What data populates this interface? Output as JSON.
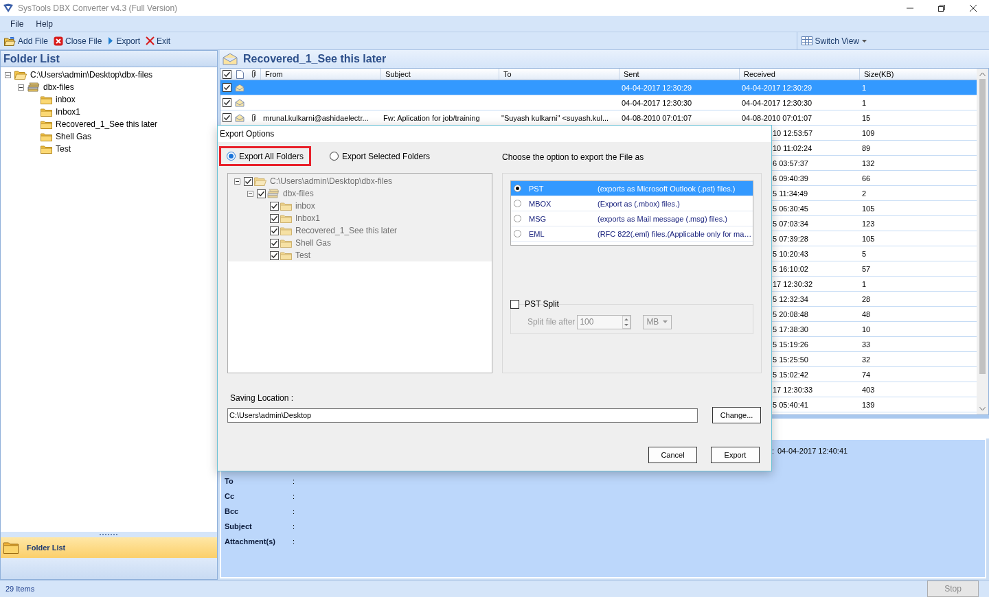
{
  "window": {
    "title": "SysTools DBX Converter v4.3 (Full Version)"
  },
  "menu": [
    "File",
    "Help"
  ],
  "toolbar": {
    "buttons": [
      {
        "kind": "add",
        "label": "Add File"
      },
      {
        "kind": "close",
        "label": "Close File"
      },
      {
        "kind": "export",
        "label": "Export"
      },
      {
        "kind": "exit",
        "label": "Exit"
      }
    ],
    "switch_view": "Switch View"
  },
  "folder_pane": {
    "title": "Folder List",
    "tree": [
      {
        "label": "C:\\Users\\admin\\Desktop\\dbx-files",
        "kind": "root",
        "expanded": true,
        "children": [
          {
            "label": "dbx-files",
            "kind": "store",
            "expanded": true,
            "children": [
              {
                "label": "inbox",
                "kind": "folder"
              },
              {
                "label": "Inbox1",
                "kind": "folder"
              },
              {
                "label": "Recovered_1_See this later",
                "kind": "folder"
              },
              {
                "label": "Shell Gas",
                "kind": "folder"
              },
              {
                "label": "Test",
                "kind": "folder"
              }
            ]
          }
        ]
      }
    ],
    "footer_tab": "Folder List"
  },
  "message_pane": {
    "title": "Recovered_1_See this later",
    "header_checked": true,
    "columns": [
      "From",
      "Subject",
      "To",
      "Sent",
      "Received",
      "Size(KB)"
    ],
    "rows": [
      {
        "kind": "full",
        "checked": true,
        "selected": true,
        "attachment": false,
        "sent": "04-04-2017 12:30:29",
        "received": "04-04-2017 12:30:29",
        "size": "1"
      },
      {
        "kind": "full",
        "checked": true,
        "selected": false,
        "attachment": false,
        "sent": "04-04-2017 12:30:30",
        "received": "04-04-2017 12:30:30",
        "size": "1"
      },
      {
        "kind": "full",
        "checked": true,
        "selected": false,
        "attachment": true,
        "from": "mrunal.kulkarni@ashidaelectr...",
        "subject": "Fw: Aplication for job/training",
        "to": "\"Suyash kulkarni\" <suyash.kul...",
        "sent": "04-08-2010 07:01:07",
        "received": "04-08-2010 07:01:07",
        "size": "15"
      },
      {
        "kind": "partial",
        "received": "10 12:53:57",
        "size": "109"
      },
      {
        "kind": "partial",
        "received": "10 11:02:24",
        "size": "89"
      },
      {
        "kind": "partial",
        "received": "6 03:57:37",
        "size": "132"
      },
      {
        "kind": "partial",
        "received": "6 09:40:39",
        "size": "66"
      },
      {
        "kind": "partial",
        "received": "5 11:34:49",
        "size": "2"
      },
      {
        "kind": "partial",
        "received": "5 06:30:45",
        "size": "105"
      },
      {
        "kind": "partial",
        "received": "5 07:03:34",
        "size": "123"
      },
      {
        "kind": "partial",
        "received": "5 07:39:28",
        "size": "105"
      },
      {
        "kind": "partial",
        "received": "5 10:20:43",
        "size": "5"
      },
      {
        "kind": "partial",
        "received": "5 16:10:02",
        "size": "57"
      },
      {
        "kind": "partial",
        "received": "17 12:30:32",
        "size": "1"
      },
      {
        "kind": "partial",
        "received": "5 12:32:34",
        "size": "28"
      },
      {
        "kind": "partial",
        "received": "5 20:08:48",
        "size": "48"
      },
      {
        "kind": "partial",
        "received": "5 17:38:30",
        "size": "10"
      },
      {
        "kind": "partial",
        "received": "5 15:19:26",
        "size": "33"
      },
      {
        "kind": "partial",
        "received": "5 15:25:50",
        "size": "32"
      },
      {
        "kind": "partial",
        "received": "5 15:02:42",
        "size": "74"
      },
      {
        "kind": "partial",
        "received": "17 12:30:33",
        "size": "403"
      },
      {
        "kind": "partial",
        "received": "5 05:40:41",
        "size": "139"
      }
    ]
  },
  "preview": {
    "date_colon": ":",
    "date_value": "04-04-2017 12:40:41",
    "fields": [
      {
        "label": "To",
        "colon": ":"
      },
      {
        "label": "Cc",
        "colon": ":"
      },
      {
        "label": "Bcc",
        "colon": ":"
      },
      {
        "label": "Subject",
        "colon": ":"
      },
      {
        "label": "Attachment(s)",
        "colon": ":"
      }
    ]
  },
  "dialog": {
    "title": "Export Options",
    "scope": [
      {
        "label": "Export All Folders",
        "selected": true,
        "highlighted": true
      },
      {
        "label": "Export Selected Folders",
        "selected": false,
        "highlighted": false
      }
    ],
    "tree_disabled": true,
    "tree": [
      {
        "label": "C:\\Users\\admin\\Desktop\\dbx-files",
        "kind": "root",
        "checked": true,
        "expanded": true,
        "children": [
          {
            "label": "dbx-files",
            "kind": "store",
            "checked": true,
            "expanded": true,
            "children": [
              {
                "label": "inbox",
                "kind": "folder",
                "checked": true
              },
              {
                "label": "Inbox1",
                "kind": "folder",
                "checked": true
              },
              {
                "label": "Recovered_1_See this later",
                "kind": "folder",
                "checked": true
              },
              {
                "label": "Shell Gas",
                "kind": "folder",
                "checked": true
              },
              {
                "label": "Test",
                "kind": "folder",
                "checked": true
              }
            ]
          }
        ]
      }
    ],
    "format_prompt": "Choose the option to export the File as",
    "formats": [
      {
        "name": "PST",
        "description": "(exports as Microsoft Outlook (.pst) files.)",
        "selected": true
      },
      {
        "name": "MBOX",
        "description": "(Export as (.mbox) files.)",
        "selected": false
      },
      {
        "name": "MSG",
        "description": "(exports as Mail message (.msg) files.)",
        "selected": false
      },
      {
        "name": "EML",
        "description": "(RFC 822(.eml) files.(Applicable only for ma…",
        "selected": false
      }
    ],
    "split": {
      "label": "PST Split",
      "checked": false,
      "after_label": "Split file after",
      "size": "100",
      "unit": "MB"
    },
    "saving_label": "Saving Location :",
    "saving_path": "C:\\Users\\admin\\Desktop",
    "change": "Change...",
    "cancel": "Cancel",
    "export": "Export"
  },
  "status_bar": {
    "items": "29 Items",
    "stop": "Stop",
    "stop_disabled": true
  }
}
